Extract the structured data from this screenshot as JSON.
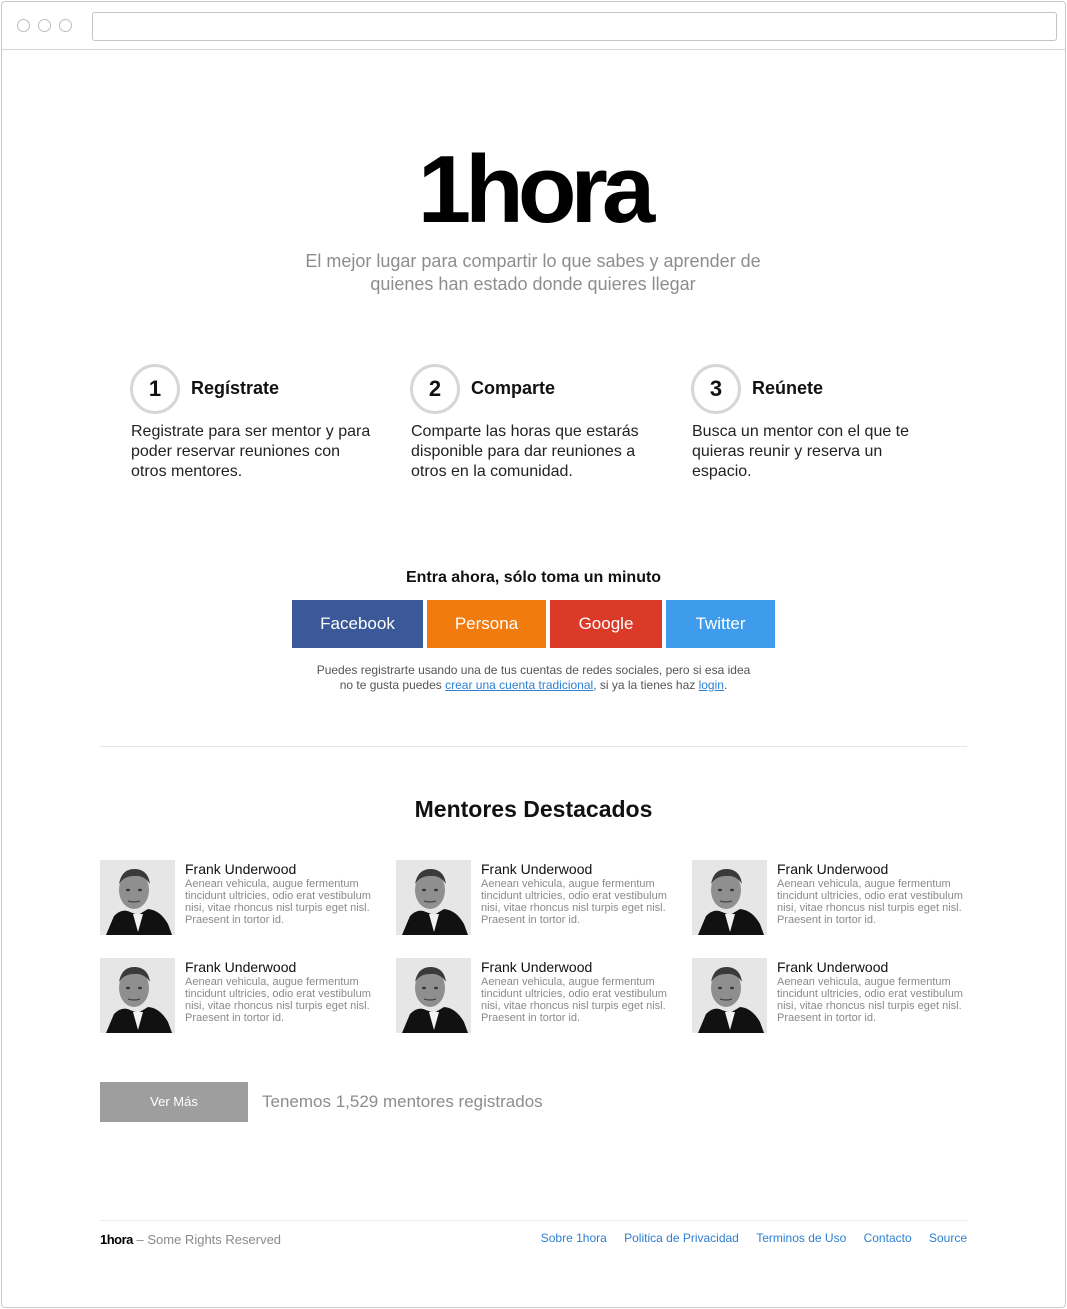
{
  "brand": {
    "logo": "1hora",
    "tagline": "El mejor lugar para compartir lo que sabes y aprender de quienes han estado donde quieres llegar"
  },
  "steps": [
    {
      "number": "1",
      "title": "Regístrate",
      "description": "Registrate para ser mentor y para poder reservar reuniones con otros mentores."
    },
    {
      "number": "2",
      "title": "Comparte",
      "description": "Comparte las horas que estarás disponible para dar reuniones a otros en la comunidad."
    },
    {
      "number": "3",
      "title": "Reúnete",
      "description": "Busca un mentor con el que te quieras reunir y reserva un espacio."
    }
  ],
  "signup": {
    "title": "Entra ahora, sólo toma un minuto",
    "buttons": [
      {
        "label": "Facebook",
        "color": "#3b5998"
      },
      {
        "label": "Persona",
        "color": "#f27b0d"
      },
      {
        "label": "Google",
        "color": "#dc3a28"
      },
      {
        "label": "Twitter",
        "color": "#3f9beb"
      }
    ],
    "note_prefix": "Puedes registrarte usando una de tus cuentas de redes sociales, pero si esa idea no te gusta puedes ",
    "note_link1": "crear una cuenta tradicional",
    "note_middle": ", si ya la tienes haz ",
    "note_link2": "login",
    "note_suffix": "."
  },
  "mentors_section": {
    "title": "Mentores Destacados",
    "mentors": [
      {
        "name": "Frank Underwood",
        "bio": "Aenean vehicula, augue fermentum tincidunt ultricies, odio erat vestibulum nisi, vitae rhoncus nisl turpis eget nisl. Praesent in tortor id."
      },
      {
        "name": "Frank Underwood",
        "bio": "Aenean vehicula, augue fermentum tincidunt ultricies, odio erat vestibulum nisi, vitae rhoncus nisl turpis eget nisl. Praesent in tortor id."
      },
      {
        "name": "Frank Underwood",
        "bio": "Aenean vehicula, augue fermentum tincidunt ultricies, odio erat vestibulum nisi, vitae rhoncus nisl turpis eget nisl. Praesent in tortor id."
      },
      {
        "name": "Frank Underwood",
        "bio": "Aenean vehicula, augue fermentum tincidunt ultricies, odio erat vestibulum nisi, vitae rhoncus nisl turpis eget nisl. Praesent in tortor id."
      },
      {
        "name": "Frank Underwood",
        "bio": "Aenean vehicula, augue fermentum tincidunt ultricies, odio erat vestibulum nisi, vitae rhoncus nisl turpis eget nisl. Praesent in tortor id."
      },
      {
        "name": "Frank Underwood",
        "bio": "Aenean vehicula, augue fermentum tincidunt ultricies, odio erat vestibulum nisi, vitae rhoncus nisl turpis eget nisl. Praesent in tortor id."
      }
    ],
    "more_button": "Ver Más",
    "count_text": "Tenemos 1,529 mentores registrados"
  },
  "footer": {
    "brand": "1hora",
    "rights": " – Some Rights Reserved",
    "links": [
      "Sobre 1hora",
      "Politica de Privacidad",
      "Terminos de Uso",
      "Contacto",
      "Source"
    ]
  }
}
